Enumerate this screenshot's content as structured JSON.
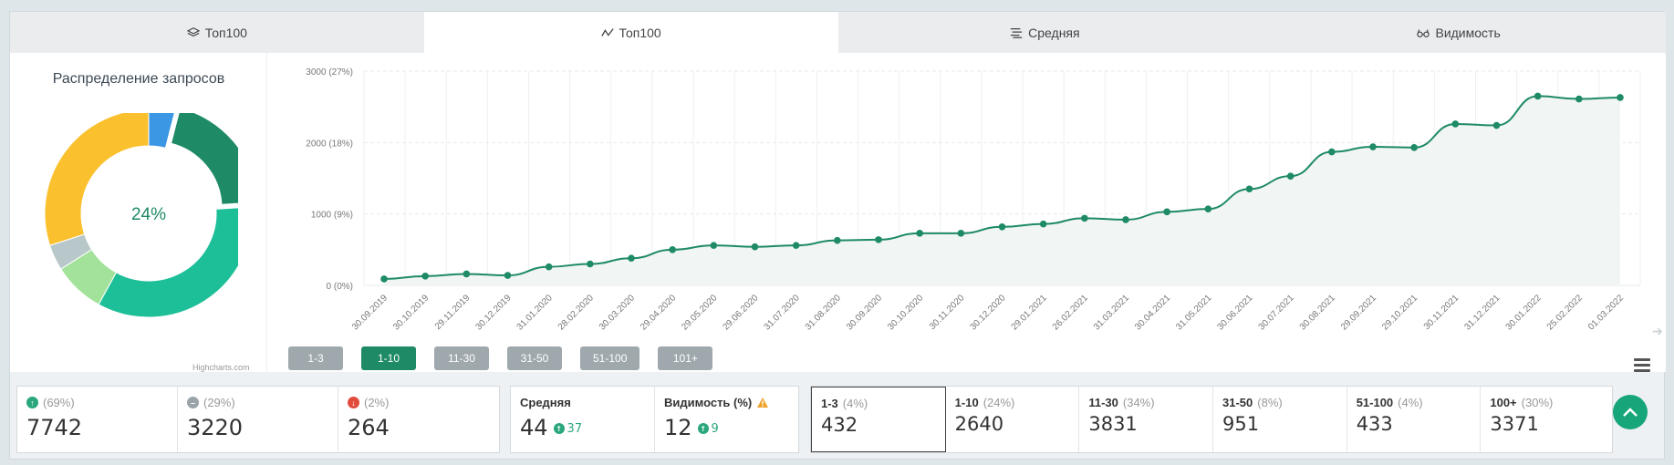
{
  "tabs": [
    {
      "label": "Топ100",
      "icon": "layers-icon",
      "active": false
    },
    {
      "label": "Топ100",
      "icon": "line-chart-icon",
      "active": true
    },
    {
      "label": "Средняя",
      "icon": "lines-icon",
      "active": false
    },
    {
      "label": "Видимость",
      "icon": "glasses-icon",
      "active": false
    }
  ],
  "pie": {
    "title": "Распределение запросов",
    "center_label": "24%",
    "credit": "Highcharts.com",
    "slices": [
      {
        "name": "1-3",
        "value": 4,
        "color": "#3b97e3"
      },
      {
        "name": "1-10",
        "value": 20,
        "color": "#1e8a66"
      },
      {
        "name": "11-30",
        "value": 34,
        "color": "#1dbf98"
      },
      {
        "name": "31-50",
        "value": 8,
        "color": "#a3e29b"
      },
      {
        "name": "51-100",
        "value": 4,
        "color": "#b8c7c9"
      },
      {
        "name": "100+",
        "value": 30,
        "color": "#fbc02d"
      }
    ]
  },
  "chart_data": {
    "type": "area",
    "title": "",
    "x": [
      "30.09.2019",
      "30.10.2019",
      "29.11.2019",
      "30.12.2019",
      "31.01.2020",
      "28.02.2020",
      "30.03.2020",
      "29.04.2020",
      "29.05.2020",
      "29.06.2020",
      "31.07.2020",
      "31.08.2020",
      "30.09.2020",
      "30.10.2020",
      "30.11.2020",
      "30.12.2020",
      "29.01.2021",
      "26.02.2021",
      "31.03.2021",
      "30.04.2021",
      "31.05.2021",
      "30.06.2021",
      "30.07.2021",
      "30.08.2021",
      "29.09.2021",
      "29.10.2021",
      "30.11.2021",
      "31.12.2021",
      "30.01.2022",
      "25.02.2022",
      "01.03.2022"
    ],
    "series": [
      {
        "values": [
          90,
          130,
          160,
          140,
          260,
          300,
          380,
          500,
          560,
          540,
          560,
          630,
          640,
          730,
          730,
          820,
          860,
          940,
          920,
          1030,
          1070,
          1350,
          1530,
          1870,
          1940,
          1930,
          2260,
          2240,
          2650,
          2610,
          2630
        ]
      }
    ],
    "y_ticks": [
      "0 (0%)",
      "1000 (9%)",
      "2000 (18%)",
      "3000 (27%)"
    ],
    "ylim": [
      0,
      3000
    ],
    "line_color": "#1e8a66",
    "grid": true
  },
  "range_buttons": [
    {
      "label": "1-3",
      "active": false
    },
    {
      "label": "1-10",
      "active": true
    },
    {
      "label": "11-30",
      "active": false
    },
    {
      "label": "31-50",
      "active": false
    },
    {
      "label": "51-100",
      "active": false
    },
    {
      "label": "101+",
      "active": false
    }
  ],
  "stats": {
    "changes": [
      {
        "icon": "arrow-up-circle-icon",
        "pct": "(69%)",
        "value": "7742",
        "color": "#2aa77e"
      },
      {
        "icon": "minus-circle-icon",
        "pct": "(29%)",
        "value": "3220",
        "color": "#9aa4a8"
      },
      {
        "icon": "arrow-down-circle-icon",
        "pct": "(2%)",
        "value": "264",
        "color": "#e14b3b"
      }
    ],
    "average": {
      "label": "Средняя",
      "value": "44",
      "delta": "37"
    },
    "visibility": {
      "label": "Видимость (%)",
      "value": "12",
      "delta": "9"
    },
    "buckets": [
      {
        "name": "1-3",
        "pct": "(4%)",
        "value": "432",
        "selected": true
      },
      {
        "name": "1-10",
        "pct": "(24%)",
        "value": "2640",
        "selected": false
      },
      {
        "name": "11-30",
        "pct": "(34%)",
        "value": "3831",
        "selected": false
      },
      {
        "name": "31-50",
        "pct": "(8%)",
        "value": "951",
        "selected": false
      },
      {
        "name": "51-100",
        "pct": "(4%)",
        "value": "433",
        "selected": false
      },
      {
        "name": "100+",
        "pct": "(30%)",
        "value": "3371",
        "selected": false
      }
    ]
  }
}
